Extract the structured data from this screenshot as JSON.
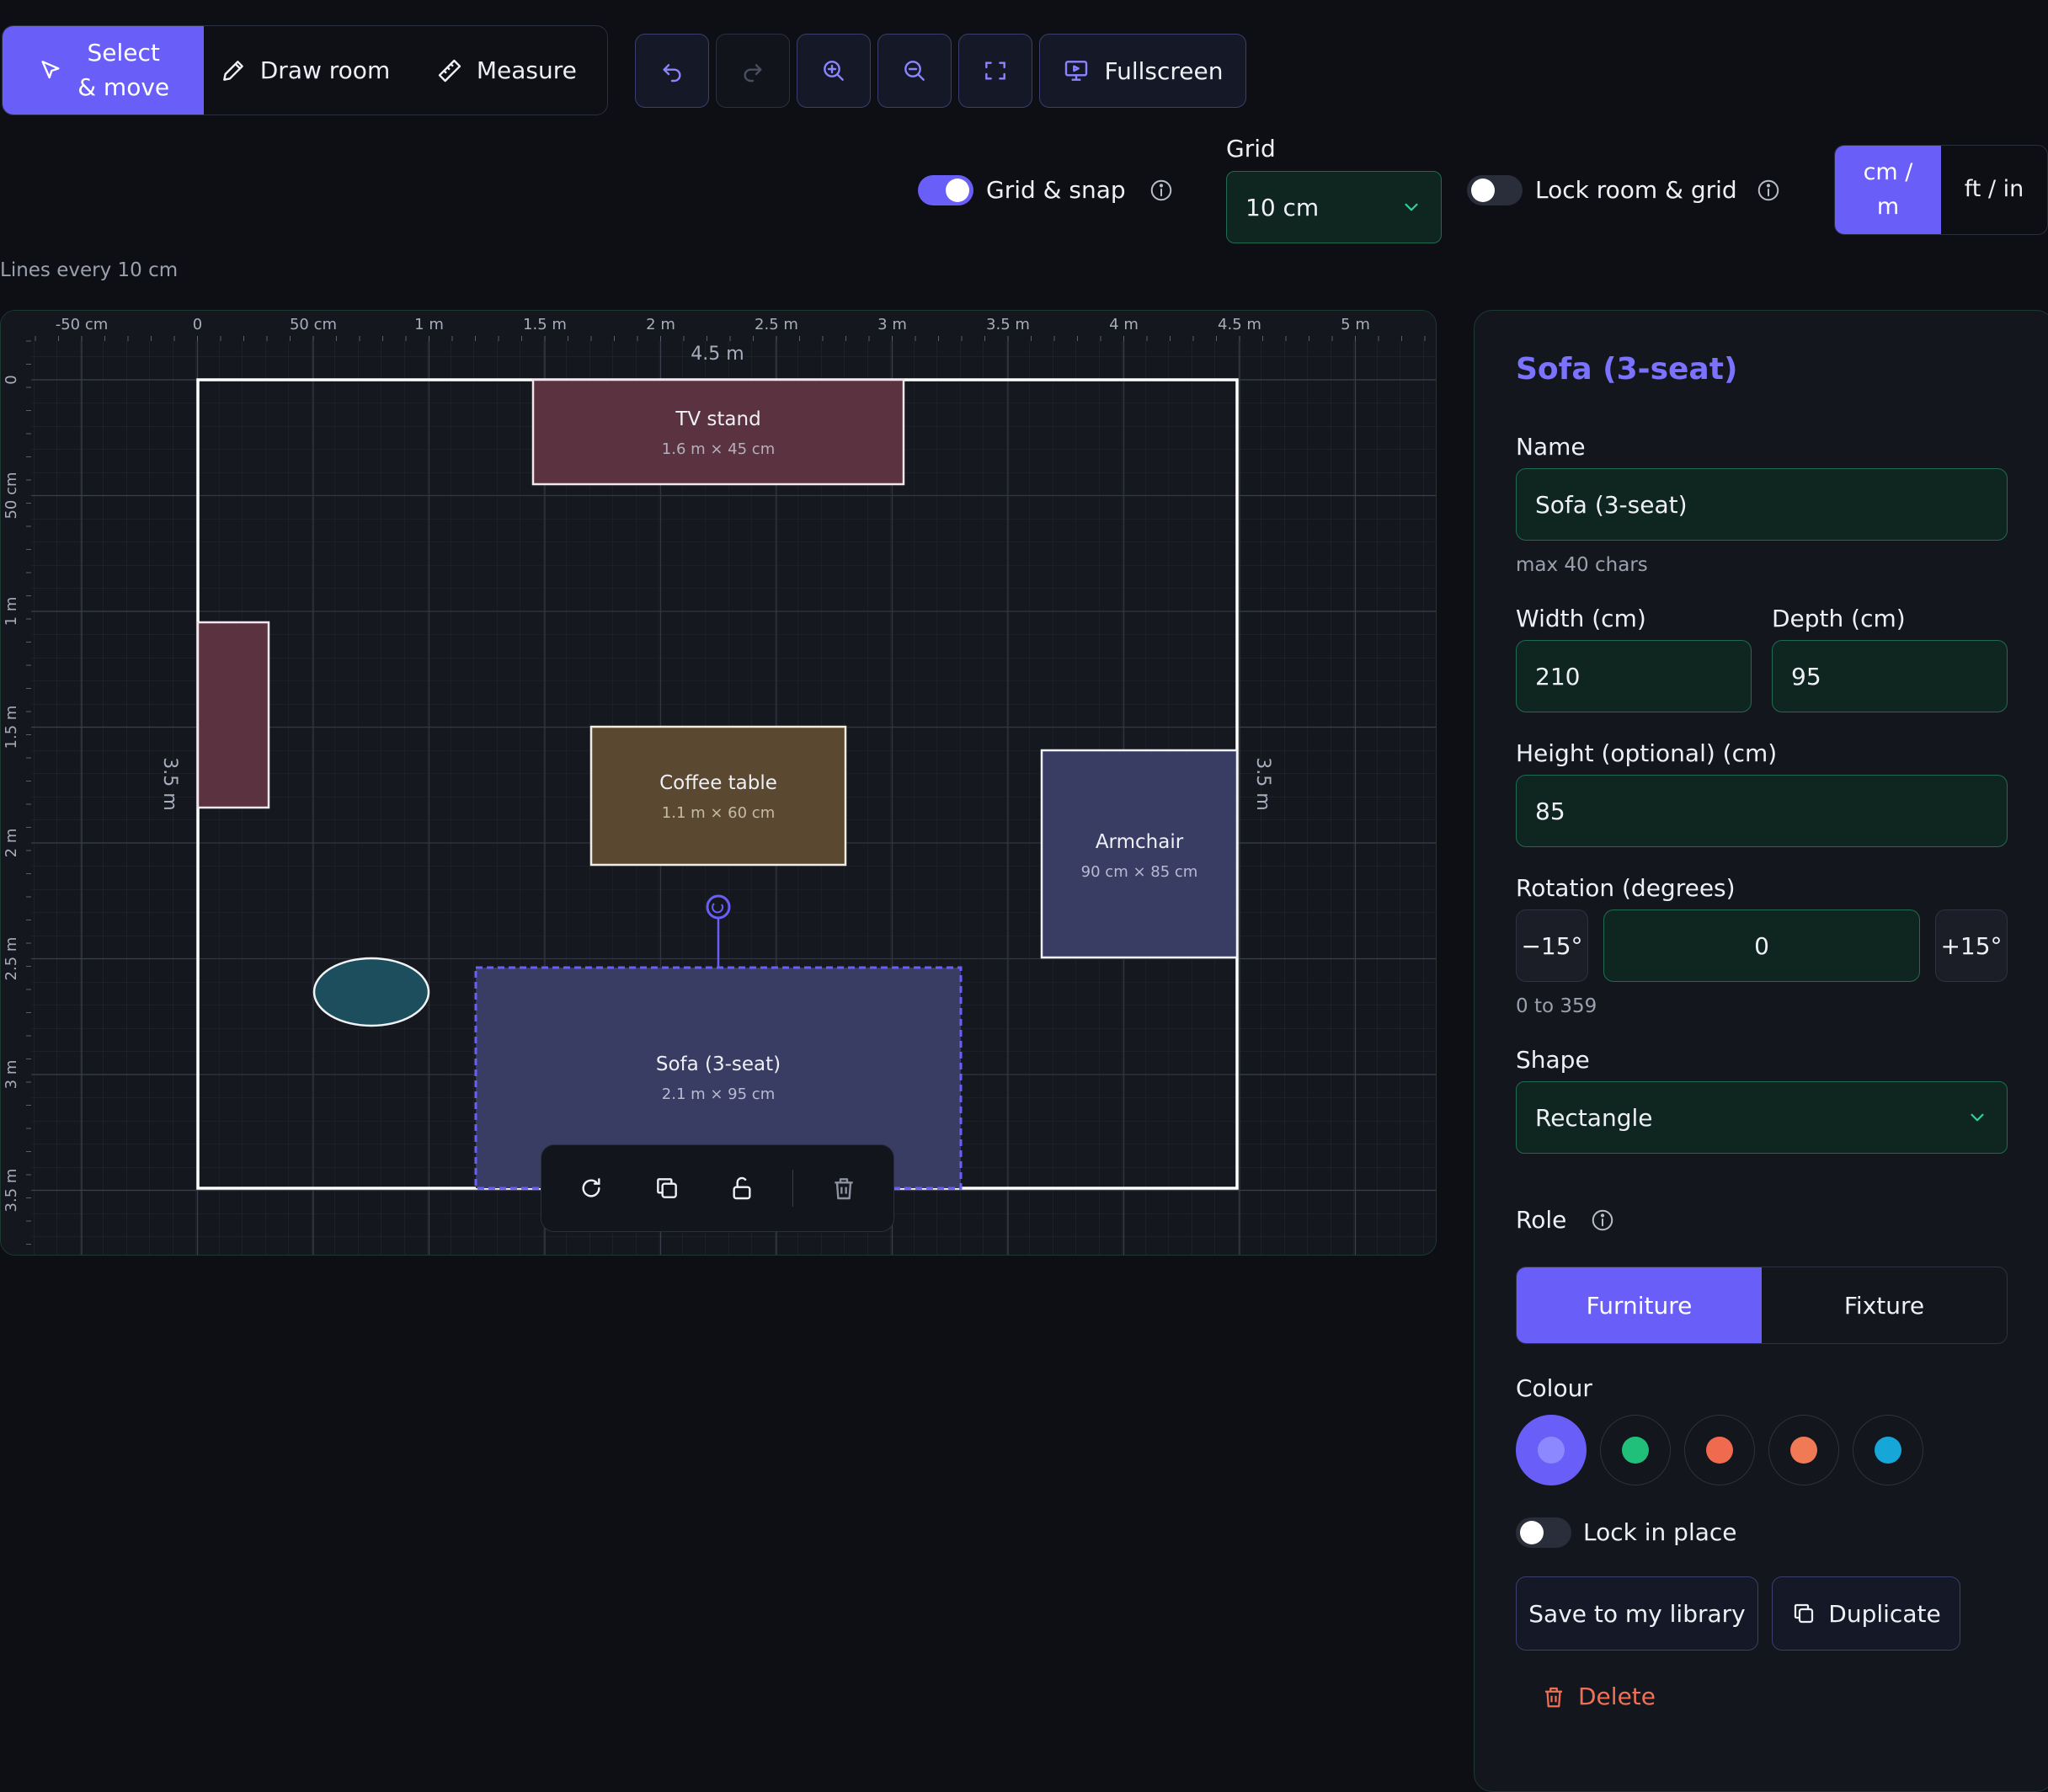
{
  "toolbar": {
    "modes": [
      {
        "label": "Select & move",
        "icon": "cursor-icon",
        "active": true
      },
      {
        "label": "Draw room",
        "icon": "pencil-icon",
        "active": false
      },
      {
        "label": "Measure",
        "icon": "ruler-icon",
        "active": false
      }
    ],
    "fullscreen_label": "Fullscreen"
  },
  "settings": {
    "grid_snap_label": "Grid & snap",
    "grid_snap_on": true,
    "grid_title": "Grid",
    "grid_value": "10 cm",
    "lock_label": "Lock room & grid",
    "lock_on": false,
    "unit_metric": "cm / m",
    "unit_imperial": "ft / in"
  },
  "canvas": {
    "hint": "Lines every 10 cm",
    "ruler_x": [
      "-50 cm",
      "0",
      "50 cm",
      "1 m",
      "1.5 m",
      "2 m",
      "2.5 m",
      "3 m",
      "3.5 m",
      "4 m",
      "4.5 m",
      "5 m"
    ],
    "ruler_y": [
      "0",
      "50 cm",
      "1 m",
      "1.5 m",
      "2 m",
      "2.5 m",
      "3 m",
      "3.5 m"
    ],
    "room_width_label": "4.5 m",
    "room_depth_label": "3.5 m",
    "items": {
      "tv_stand": {
        "name": "TV stand",
        "dims": "1.6 m × 45 cm",
        "color": "#5a3240"
      },
      "coffee_table": {
        "name": "Coffee table",
        "dims": "1.1 m × 60 cm",
        "color": "#5a4930"
      },
      "armchair": {
        "name": "Armchair",
        "dims": "90 cm × 85 cm",
        "color": "#393d63"
      },
      "sofa": {
        "name": "Sofa (3-seat)",
        "dims": "2.1 m × 95 cm",
        "color": "#393d63"
      },
      "side_cabinet": {
        "color": "#5a3240"
      },
      "round_table": {
        "color": "#1c4e5e"
      }
    }
  },
  "panel": {
    "title": "Sofa (3-seat)",
    "name_label": "Name",
    "name_value": "Sofa (3-seat)",
    "name_hint": "max 40 chars",
    "width_label": "Width (cm)",
    "width_value": "210",
    "depth_label": "Depth (cm)",
    "depth_value": "95",
    "height_label": "Height (optional) (cm)",
    "height_value": "85",
    "rotation_label": "Rotation (degrees)",
    "rotation_minus": "−15°",
    "rotation_value": "0",
    "rotation_plus": "+15°",
    "rotation_hint": "0 to 359",
    "shape_label": "Shape",
    "shape_value": "Rectangle",
    "role_label": "Role",
    "role_furniture": "Furniture",
    "role_fixture": "Fixture",
    "colour_label": "Colour",
    "colours": [
      "#6a6cf0",
      "#21c07a",
      "#f06a50",
      "#f07a55",
      "#16a6d8"
    ],
    "lock_label": "Lock in place",
    "save_label": "Save to my library",
    "duplicate_label": "Duplicate",
    "delete_label": "Delete"
  }
}
